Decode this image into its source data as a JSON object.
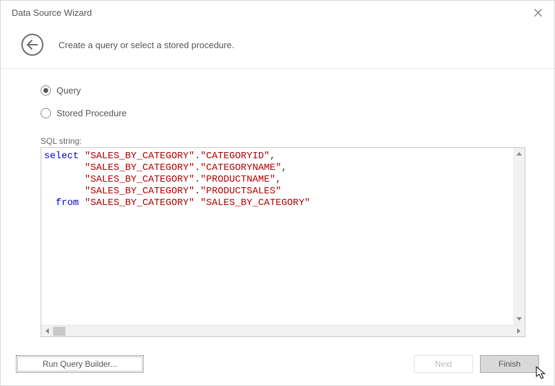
{
  "window": {
    "title": "Data Source Wizard",
    "subtitle": "Create a query or select a stored procedure."
  },
  "options": {
    "query_label": "Query",
    "stored_procedure_label": "Stored Procedure",
    "selected": "query"
  },
  "sql": {
    "label": "SQL string:",
    "tokens": [
      {
        "t": "kw",
        "v": "select"
      },
      {
        "t": "sp",
        "v": " "
      },
      {
        "t": "str",
        "v": "\"SALES_BY_CATEGORY\""
      },
      {
        "t": "p",
        "v": "."
      },
      {
        "t": "str",
        "v": "\"CATEGORYID\""
      },
      {
        "t": "p",
        "v": ","
      },
      {
        "t": "nl"
      },
      {
        "t": "pad",
        "v": "       "
      },
      {
        "t": "str",
        "v": "\"SALES_BY_CATEGORY\""
      },
      {
        "t": "p",
        "v": "."
      },
      {
        "t": "str",
        "v": "\"CATEGORYNAME\""
      },
      {
        "t": "p",
        "v": ","
      },
      {
        "t": "nl"
      },
      {
        "t": "pad",
        "v": "       "
      },
      {
        "t": "str",
        "v": "\"SALES_BY_CATEGORY\""
      },
      {
        "t": "p",
        "v": "."
      },
      {
        "t": "str",
        "v": "\"PRODUCTNAME\""
      },
      {
        "t": "p",
        "v": ","
      },
      {
        "t": "nl"
      },
      {
        "t": "pad",
        "v": "       "
      },
      {
        "t": "str",
        "v": "\"SALES_BY_CATEGORY\""
      },
      {
        "t": "p",
        "v": "."
      },
      {
        "t": "str",
        "v": "\"PRODUCTSALES\""
      },
      {
        "t": "nl"
      },
      {
        "t": "pad",
        "v": "  "
      },
      {
        "t": "kw",
        "v": "from"
      },
      {
        "t": "sp",
        "v": " "
      },
      {
        "t": "str",
        "v": "\"SALES_BY_CATEGORY\""
      },
      {
        "t": "sp",
        "v": " "
      },
      {
        "t": "str",
        "v": "\"SALES_BY_CATEGORY\""
      }
    ]
  },
  "buttons": {
    "run_query_builder": "Run Query Builder...",
    "next": "Next",
    "finish": "Finish"
  }
}
